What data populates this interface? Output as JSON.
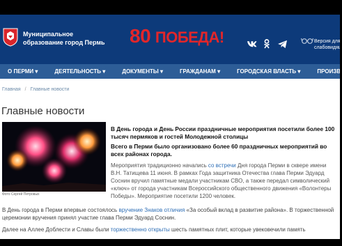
{
  "header": {
    "municipality_line1": "Муниципальное",
    "municipality_line2": "образование город Пермь",
    "banner_number": "80",
    "banner_word": "ПОБЕДА!",
    "socials": [
      "vk-icon",
      "odnoklassniki-icon",
      "telegram-icon"
    ],
    "vision_line1": "Версия для",
    "vision_line2": "слабовидящ"
  },
  "nav": {
    "items": [
      "О ПЕРМИ ▾",
      "ДЕЯТЕЛЬНОСТЬ ▾",
      "ДОКУМЕНТЫ ▾",
      "ГРАЖДАНАМ ▾",
      "ГОРОДСКАЯ ВЛАСТЬ ▾",
      "ПРОИЗВОДСТВЕ"
    ]
  },
  "breadcrumb": {
    "home": "Главная",
    "sep": "/",
    "current": "Главные новости"
  },
  "page_title": "Главные новости",
  "article": {
    "photo_caption": "Фото Сергей Петровых",
    "lead_1": "В День города и День России праздничные мероприятия посетили более 100 тысяч пермяков и гостей Молодежной столицы",
    "lead_2": "Всего в Перми было организовано более 60 праздничных мероприятий во всех районах города.",
    "p1_before": "Мероприятия традиционно начались ",
    "p1_link": "со встречи",
    "p1_after": " Дня города Перми в сквере имени В.Н. Татищева 11 июня. В рамках Года защитника Отечества глава Перми Эдуард Соснин вручил памятные медали участникам СВО, а также передал символический «ключ» от города участникам Всероссийского общественного движения «Волонтеры Победы». Мероприятие посетили 1200 человек.",
    "p2_before": "В День города в Перми впервые состоялось ",
    "p2_link": "вручение Знаков отличия",
    "p2_after": " «За особый вклад в развитие района». В торжественной церемонии вручения принял участие глава Перми Эдуард Соснин.",
    "p3_before": "Далее на Аллее Доблести и Славы были ",
    "p3_link": "торжественно открыты",
    "p3_after": " шесть памятных плит, которые увековечили память"
  },
  "colors": {
    "header_bg": "#0d3a7a",
    "nav_bg": "#2d5d97",
    "banner_red": "#e2262a",
    "link": "#2f6fb6"
  }
}
